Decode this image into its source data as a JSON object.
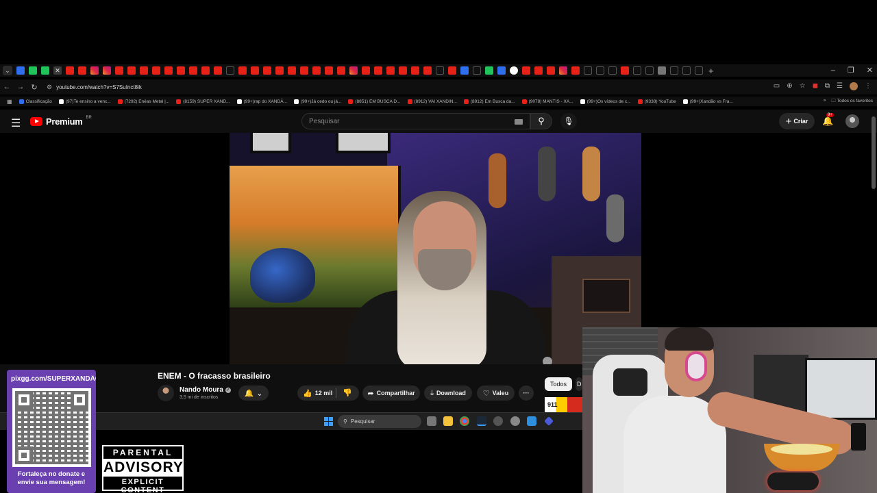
{
  "browser": {
    "url": "youtube.com/watch?v=S7SuInct8ik",
    "tabs_new": "+",
    "window_controls": [
      "–",
      "❐",
      "✕"
    ],
    "bookmarks": [
      {
        "label": "Classificação",
        "icon": "blue"
      },
      {
        "label": "(97)Te ensino a venc...",
        "icon": "tt"
      },
      {
        "label": "(7292) Enéas Metal |...",
        "icon": "yt"
      },
      {
        "label": "(8159) SUPER XAND...",
        "icon": "yt"
      },
      {
        "label": "(99+)rap do XANDÃ...",
        "icon": "tt"
      },
      {
        "label": "(99+)Já cedo ou já...",
        "icon": "tt"
      },
      {
        "label": "(8851) EM BUSCA D...",
        "icon": "yt"
      },
      {
        "label": "(8912) VAI XANDIN...",
        "icon": "yt"
      },
      {
        "label": "(8912) Em Busca da...",
        "icon": "yt"
      },
      {
        "label": "(9078) MANTIS - XA...",
        "icon": "yt"
      },
      {
        "label": "(99+)Os vídeos de c...",
        "icon": "tt"
      },
      {
        "label": "(9338) YouTube",
        "icon": "yt"
      },
      {
        "label": "(99+)Xandão vs Fra...",
        "icon": "tt"
      }
    ],
    "bookmarks_overflow": "»",
    "all_favorites": "Todos os favoritos"
  },
  "youtube": {
    "brand": "Premium",
    "country": "BR",
    "search_placeholder": "Pesquisar",
    "create_label": "Criar",
    "notifications_badge": "9+"
  },
  "video": {
    "title": "ENEM - O fracasso brasileiro",
    "channel": "Nando Moura",
    "subscribers": "3,5 mi de inscritos",
    "likes": "12 mil",
    "share_label": "Compartilhar",
    "download_label": "Download",
    "thanks_label": "Valeu",
    "more_label": "···",
    "chips": [
      "Todos",
      "D"
    ],
    "ad_text": "911"
  },
  "taskbar": {
    "search_label": "Pesquisar"
  },
  "overlay": {
    "qr_url": "pixgg.com/SUPERXANDÃO",
    "qr_caption_line1": "Fortaleça no donate e",
    "qr_caption_line2": "envie sua mensagem!",
    "advisory_top": "PARENTAL",
    "advisory_mid": "ADVISORY",
    "advisory_bottom": "EXPLICIT CONTENT"
  },
  "colors": {
    "youtube_red": "#ff0000",
    "page_bg": "#0f0f0f",
    "qr_card": "#6a3fb0"
  }
}
